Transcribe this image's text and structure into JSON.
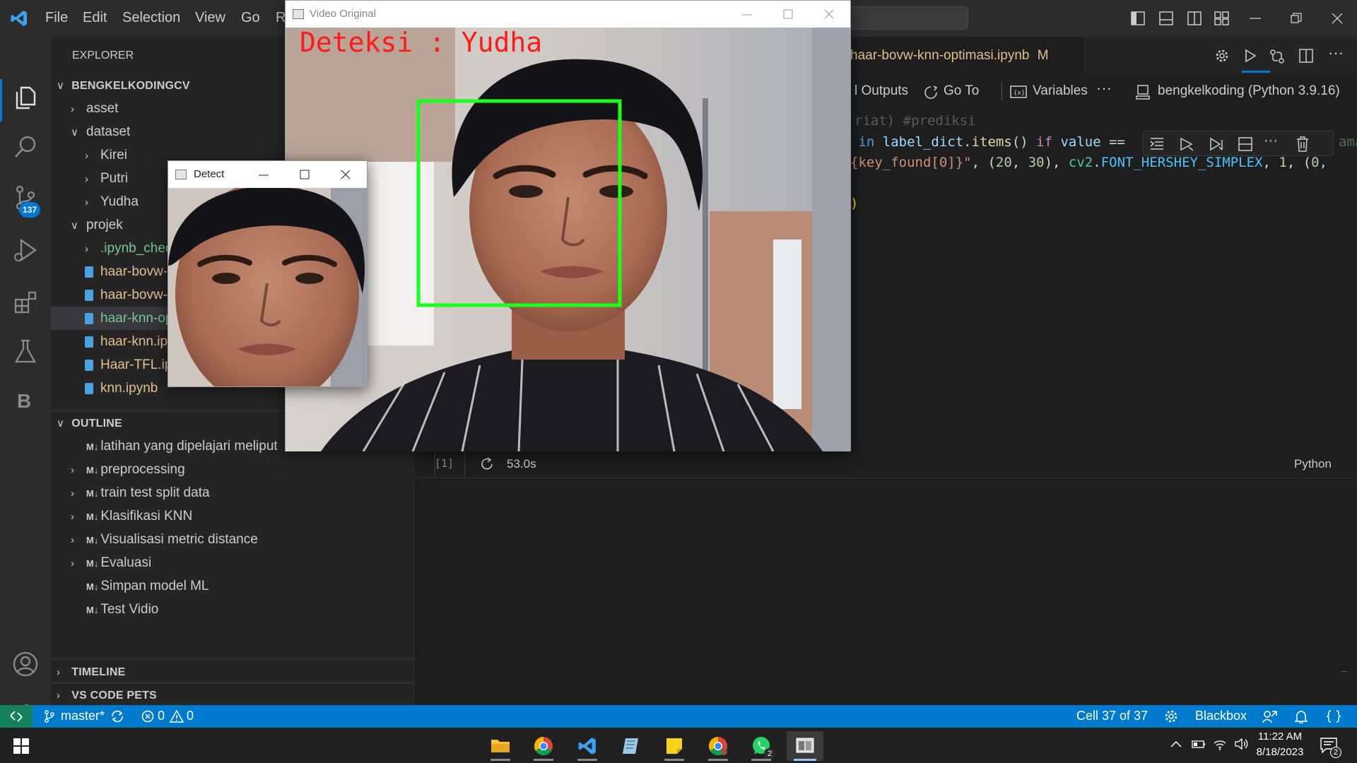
{
  "menu": [
    "File",
    "Edit",
    "Selection",
    "View",
    "Go",
    "R"
  ],
  "activity": {
    "scm_badge": "137",
    "b_label": "B"
  },
  "sidebar": {
    "explorer_title": "EXPLORER",
    "root_folder": "BENGKELKODINGCV",
    "tree": [
      {
        "label": "asset",
        "indent": 1,
        "type": "folder",
        "open": false
      },
      {
        "label": "dataset",
        "indent": 1,
        "type": "folder",
        "open": true
      },
      {
        "label": "Kirei",
        "indent": 2,
        "type": "folder",
        "open": false
      },
      {
        "label": "Putri",
        "indent": 2,
        "type": "folder",
        "open": false
      },
      {
        "label": "Yudha",
        "indent": 2,
        "type": "folder",
        "open": false
      },
      {
        "label": "projek",
        "indent": 1,
        "type": "folder",
        "open": true
      },
      {
        "label": ".ipynb_chec",
        "indent": 2,
        "type": "folder",
        "open": false,
        "color": "#73c991"
      },
      {
        "label": "haar-bovw-",
        "indent": 2,
        "type": "file",
        "color": "#e2c08d"
      },
      {
        "label": "haar-bovw-l",
        "indent": 2,
        "type": "file",
        "color": "#e2c08d"
      },
      {
        "label": "haar-knn-op",
        "indent": 2,
        "type": "file",
        "color": "#73c991",
        "selected": true
      },
      {
        "label": "haar-knn.ipy",
        "indent": 2,
        "type": "file",
        "color": "#e2c08d"
      },
      {
        "label": "Haar-TFL.ipy",
        "indent": 2,
        "type": "file",
        "color": "#e2c08d"
      },
      {
        "label": "knn.ipynb",
        "indent": 2,
        "type": "file",
        "color": "#e2c08d"
      }
    ],
    "outline_title": "OUTLINE",
    "outline": [
      {
        "label": "latihan yang dipelajari meliput",
        "chevron": false
      },
      {
        "label": "preprocessing",
        "chevron": true
      },
      {
        "label": "train test split data",
        "chevron": true
      },
      {
        "label": "Klasifikasi KNN",
        "chevron": true
      },
      {
        "label": "Visualisasi metric distance",
        "chevron": true
      },
      {
        "label": "Evaluasi",
        "chevron": true
      },
      {
        "label": "Simpan model ML",
        "chevron": false
      },
      {
        "label": "Test Vidio",
        "chevron": false
      }
    ],
    "md_badge": "M↓",
    "timeline_title": "TIMELINE",
    "pets_title": "VS CODE PETS"
  },
  "editor": {
    "tab_label": "haar-bovw-knn-optimasi.ipynb",
    "tab_modified": "M",
    "toolbar": {
      "outputs": "l Outputs",
      "goto": "Go To",
      "variables": "Variables",
      "more": "···",
      "kernel": "bengkelkoding (Python 3.9.16)"
    },
    "code_line_faded": "riat) #prediksi",
    "code_line_1": [
      {
        "t": " in ",
        "c": "#569cd6"
      },
      {
        "t": "label_dict",
        "c": "#9cdcfe"
      },
      {
        "t": ".",
        "c": "#d4d4d4"
      },
      {
        "t": "items",
        "c": "#dcdcaa"
      },
      {
        "t": "() ",
        "c": "#d4d4d4"
      },
      {
        "t": "if ",
        "c": "#c586c0"
      },
      {
        "t": "value ",
        "c": "#9cdcfe"
      },
      {
        "t": "== ",
        "c": "#d4d4d4"
      }
    ],
    "code_line_1_tail": "aman",
    "code_line_2": [
      {
        "t": "{key_found[0]}\"",
        "c": "#ce9178"
      },
      {
        "t": ", (",
        "c": "#d4d4d4"
      },
      {
        "t": "20",
        "c": "#b5cea8"
      },
      {
        "t": ", ",
        "c": "#d4d4d4"
      },
      {
        "t": "30",
        "c": "#b5cea8"
      },
      {
        "t": "), ",
        "c": "#d4d4d4"
      },
      {
        "t": "cv2",
        "c": "#4ec9b0"
      },
      {
        "t": ".",
        "c": "#d4d4d4"
      },
      {
        "t": "FONT_HERSHEY_SIMPLEX",
        "c": "#4fc1ff"
      },
      {
        "t": ", ",
        "c": "#d4d4d4"
      },
      {
        "t": "1",
        "c": "#b5cea8"
      },
      {
        "t": ", (",
        "c": "#d4d4d4"
      },
      {
        "t": "0",
        "c": "#b5cea8"
      },
      {
        "t": ",",
        "c": "#d4d4d4"
      }
    ],
    "code_line_3": ")",
    "cell_exec": "[1]",
    "cell_time": "53.0s",
    "cell_lang": "Python"
  },
  "status": {
    "branch": "master*",
    "errors": "0",
    "warnings": "0",
    "cell_pos": "Cell 37 of 37",
    "blackbox": "Blackbox"
  },
  "taskbar": {
    "time": "11:22 AM",
    "date": "8/18/2023",
    "whatsapp_badge": "2",
    "notif_badge": "2"
  },
  "video_window": {
    "title": "Video Original",
    "overlay_text": "Deteksi : Yudha",
    "box_color": "#1aff1a",
    "text_color": "#ff1a1a"
  },
  "detect_window": {
    "title": "Detect"
  }
}
